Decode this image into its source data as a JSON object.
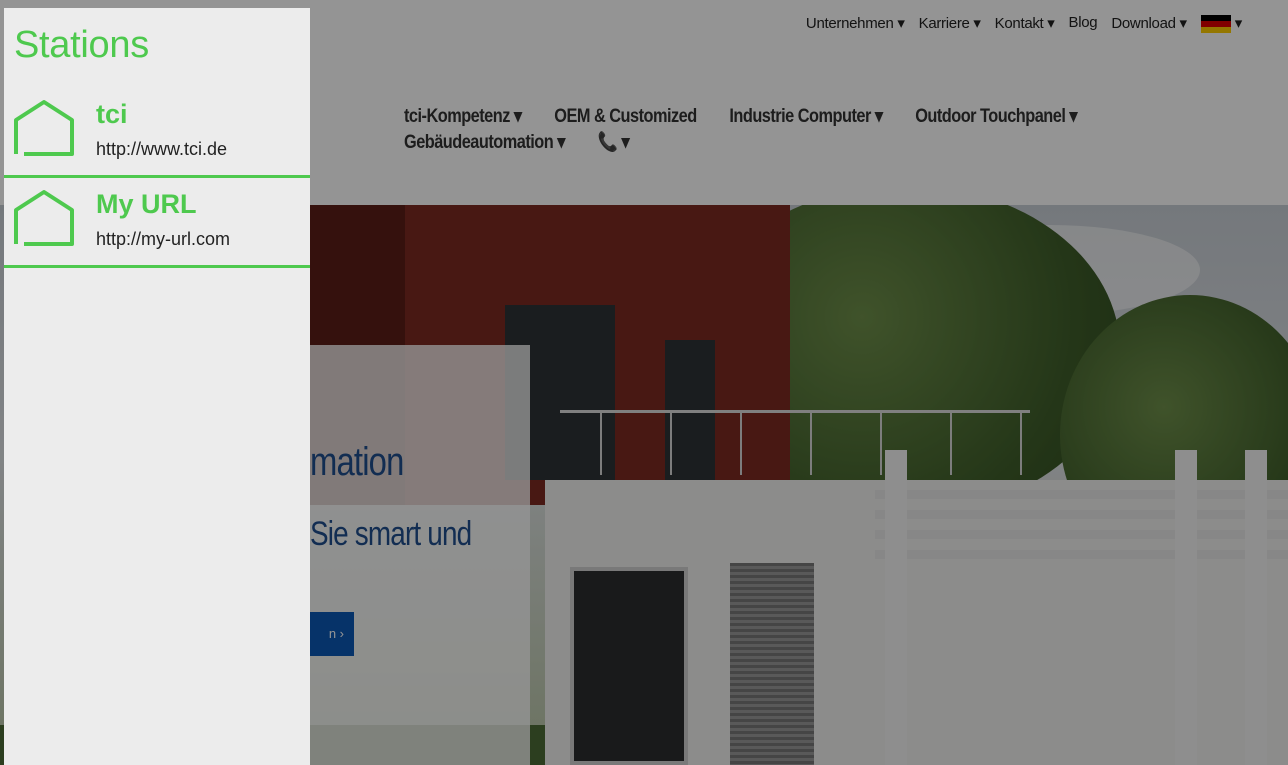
{
  "drawer": {
    "title": "Stations",
    "stations": [
      {
        "name": "tci",
        "url": "http://www.tci.de",
        "icon": "house-icon"
      },
      {
        "name": "My URL",
        "url": "http://my-url.com",
        "icon": "house-icon"
      }
    ]
  },
  "website": {
    "top_nav": [
      "Unternehmen ▾",
      "Karriere ▾",
      "Kontakt ▾",
      "Blog",
      "Download ▾"
    ],
    "language_suffix": "▾",
    "main_nav_row1": [
      "tci-Kompetenz ▾",
      "OEM & Customized",
      "Industrie Computer ▾",
      "Outdoor Touchpanel ▾"
    ],
    "main_nav_row2": [
      "Gebäudeautomation ▾",
      "📞 ▾"
    ],
    "hero_title": "mation",
    "hero_subtitle": "Sie smart und",
    "hero_cta": "n ›"
  },
  "colors": {
    "accent": "#4ec94e",
    "drawer_bg": "#ececec",
    "hero_text": "#1f4f8e",
    "cta": "#0b59b5"
  }
}
